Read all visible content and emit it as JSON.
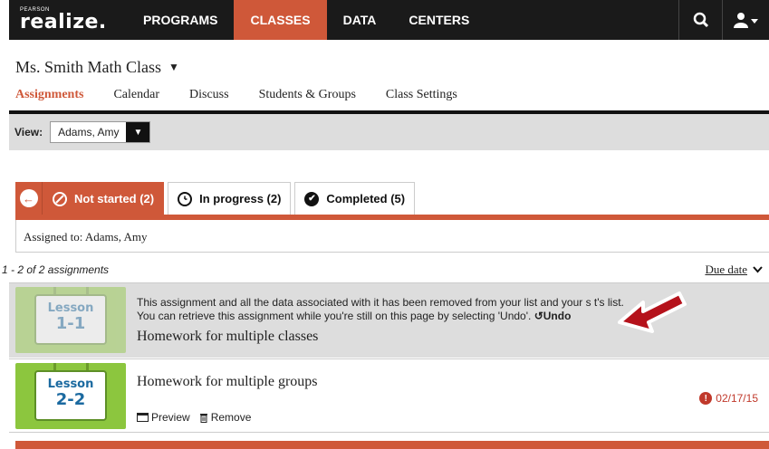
{
  "nav": {
    "logo_small": "PEARSON",
    "logo": "realize.",
    "items": [
      "PROGRAMS",
      "CLASSES",
      "DATA",
      "CENTERS"
    ],
    "active_index": 1
  },
  "class": {
    "title": "Ms. Smith Math Class",
    "tabs": [
      "Assignments",
      "Calendar",
      "Discuss",
      "Students & Groups",
      "Class Settings"
    ]
  },
  "view": {
    "label": "View:",
    "selected": "Adams, Amy"
  },
  "status_tabs": {
    "not_started": "Not started (2)",
    "in_progress": "In progress (2)",
    "completed": "Completed (5)"
  },
  "assigned_to": "Assigned to: Adams, Amy",
  "list": {
    "count": "1 - 2 of 2 assignments",
    "sort_label": "Due date"
  },
  "rows": [
    {
      "thumb_line1": "Lesson",
      "thumb_line2": "1-1",
      "message_line1": "This assignment and all the data associated with it has been removed from your list and your s  t's list.",
      "message_line2": "You can retrieve this assignment while you're still on this page by selecting 'Undo'.",
      "undo_label": "Undo",
      "title": "Homework for multiple classes"
    },
    {
      "thumb_line1": "Lesson",
      "thumb_line2": "2-2",
      "title": "Homework for multiple groups",
      "preview_label": "Preview",
      "remove_label": "Remove",
      "due_date": "02/17/15"
    }
  ],
  "colors": {
    "accent": "#cf5839",
    "nav_bg": "#1a1a1a",
    "alert": "#c0392b",
    "thumb_green": "#8cc63e",
    "thumb_text": "#1b6aa0"
  }
}
